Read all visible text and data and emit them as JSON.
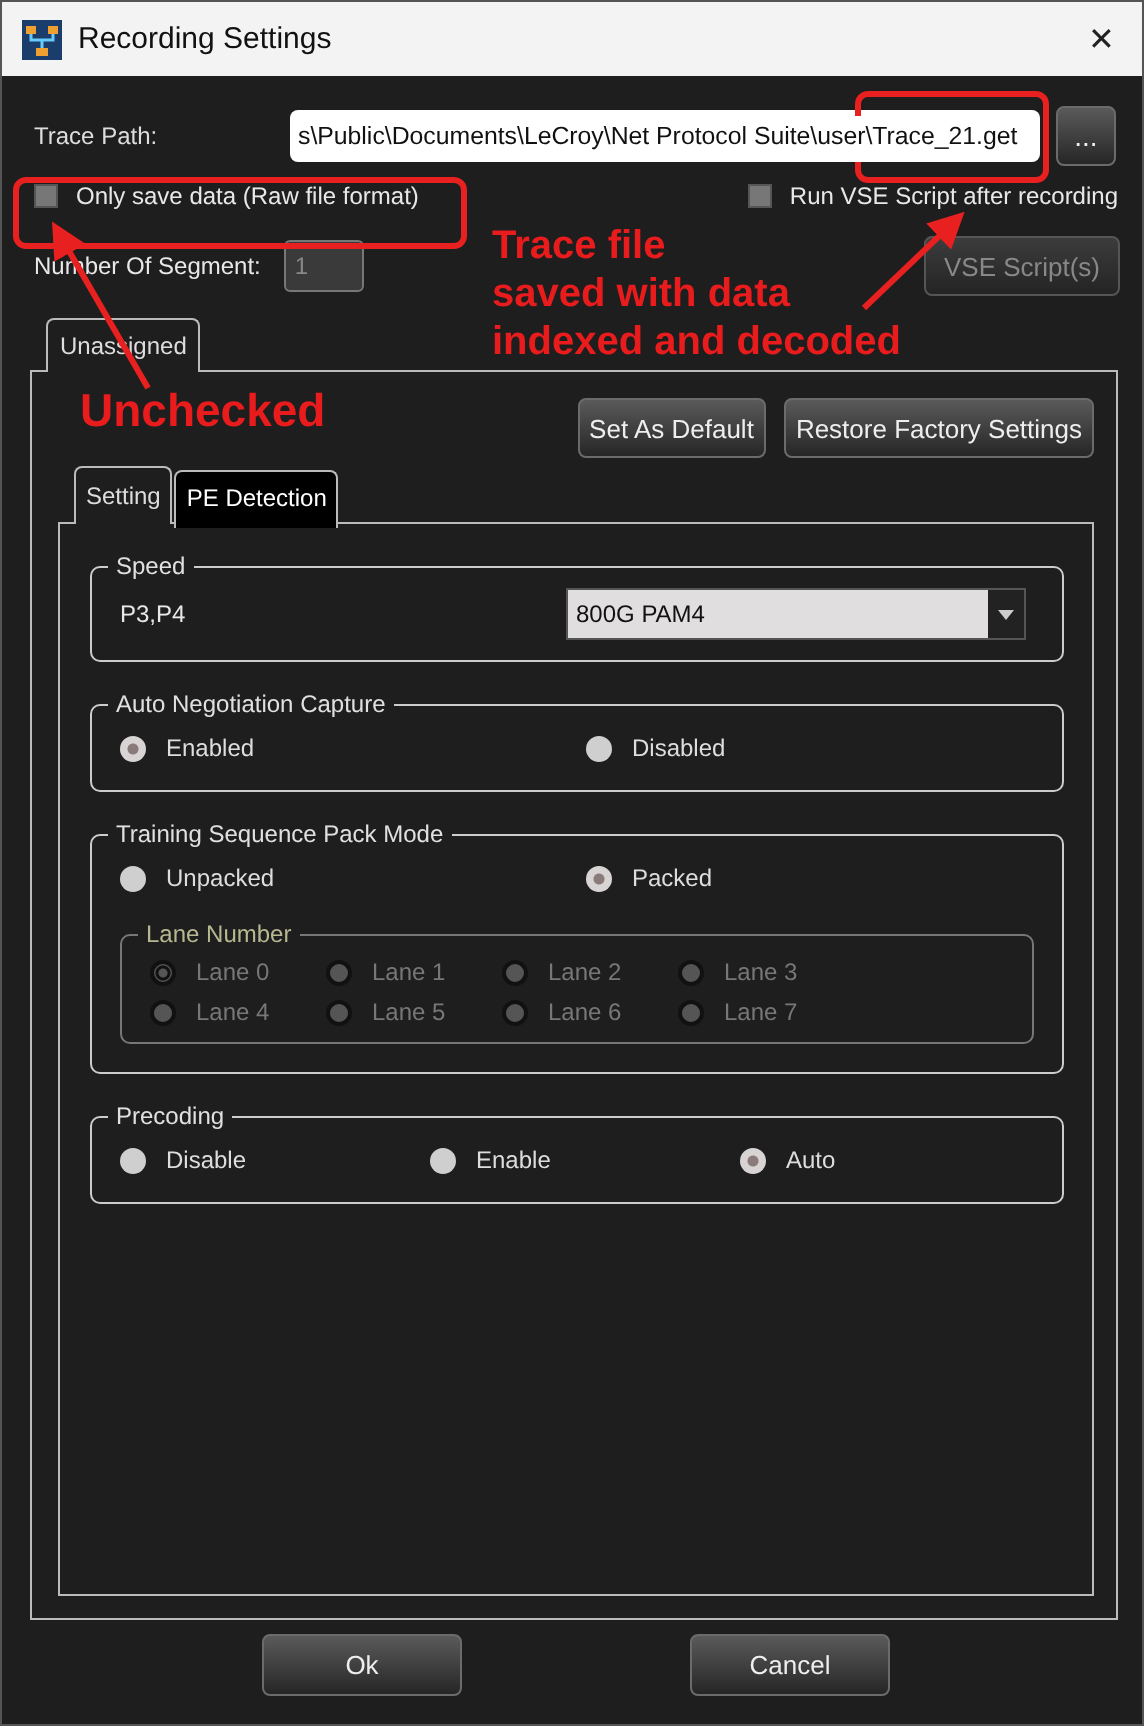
{
  "window": {
    "title": "Recording Settings",
    "close": "✕"
  },
  "trace_path": {
    "label": "Trace Path:",
    "value": "s\\Public\\Documents\\LeCroy\\Net Protocol Suite\\user\\Trace_21.get",
    "browse": "..."
  },
  "options": [
    {
      "label": "Only save data (Raw file format)",
      "checked": false
    },
    {
      "label": "Run VSE Script after recording",
      "checked": false
    }
  ],
  "segments": {
    "label": "Number Of Segment:",
    "value": "1",
    "disabled": true
  },
  "vse_button": {
    "label": "VSE Script(s)",
    "disabled": true
  },
  "port_tabs": [
    {
      "label": "Unassigned",
      "selected": true
    }
  ],
  "action_buttons": [
    "Set As Default",
    "Restore Factory Settings"
  ],
  "settings_tabs": [
    {
      "label": "Setting",
      "selected": true
    },
    {
      "label": "PE Detection",
      "selected": false
    }
  ],
  "speed": {
    "title": "Speed",
    "label": "P3,P4",
    "value": "800G PAM4"
  },
  "auto_negotiation": {
    "title": "Auto Negotiation Capture",
    "options": [
      {
        "label": "Enabled",
        "selected": true
      },
      {
        "label": "Disabled",
        "selected": false
      }
    ]
  },
  "training": {
    "title": "Training Sequence Pack Mode",
    "options": [
      {
        "label": "Unpacked",
        "selected": false
      },
      {
        "label": "Packed",
        "selected": true
      }
    ],
    "lanes": {
      "title": "Lane Number",
      "disabled": true,
      "items": [
        {
          "label": "Lane 0",
          "selected": true
        },
        {
          "label": "Lane 1",
          "selected": false
        },
        {
          "label": "Lane 2",
          "selected": false
        },
        {
          "label": "Lane 3",
          "selected": false
        },
        {
          "label": "Lane 4",
          "selected": false
        },
        {
          "label": "Lane 5",
          "selected": false
        },
        {
          "label": "Lane 6",
          "selected": false
        },
        {
          "label": "Lane 7",
          "selected": false
        }
      ]
    }
  },
  "precoding": {
    "title": "Precoding",
    "options": [
      {
        "label": "Disable",
        "selected": false
      },
      {
        "label": "Enable",
        "selected": false
      },
      {
        "label": "Auto",
        "selected": true
      }
    ]
  },
  "buttons": [
    "Ok",
    "Cancel"
  ],
  "annotations": [
    {
      "kind": "note",
      "lines": [
        "Trace file",
        "saved with data",
        "indexed and decoded"
      ]
    },
    {
      "kind": "note",
      "lines": [
        "Unchecked"
      ]
    }
  ]
}
